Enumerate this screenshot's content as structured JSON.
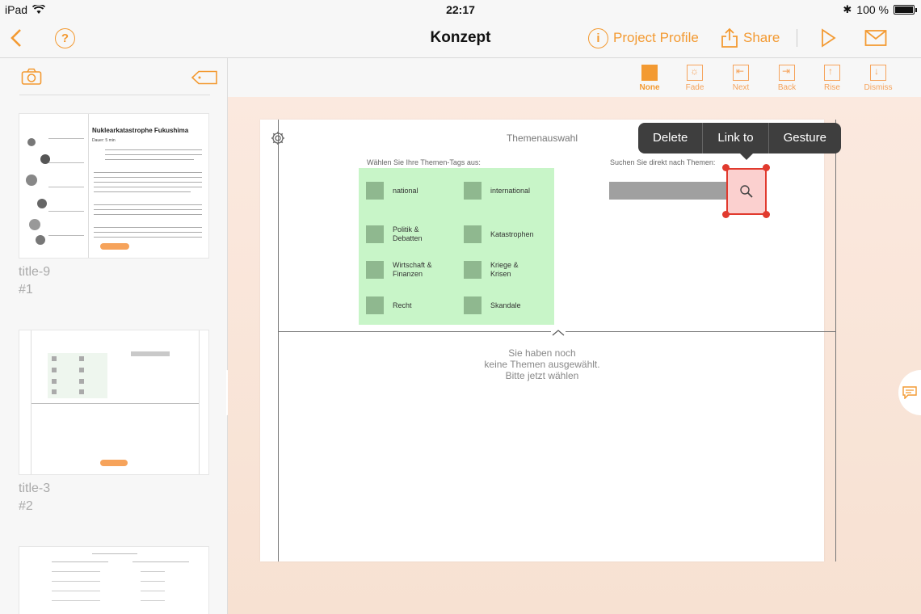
{
  "status": {
    "device": "iPad",
    "time": "22:17",
    "battery": "100 %"
  },
  "nav": {
    "title": "Konzept",
    "help": "?",
    "project_profile": "Project Profile",
    "project_profile_icon": "i",
    "share": "Share"
  },
  "sidebar": {
    "thumbnails": [
      {
        "title": "title-9",
        "number": "#1",
        "heading": "Nuklearkatastrophe Fukushima",
        "sub": "Dauer: 5 min"
      },
      {
        "title": "title-3",
        "number": "#2"
      },
      {
        "title": "",
        "number": ""
      }
    ]
  },
  "transitions": [
    {
      "label": "None",
      "icon": "none-icon",
      "active": true
    },
    {
      "label": "Fade",
      "icon": "fade-icon"
    },
    {
      "label": "Next",
      "icon": "next-icon"
    },
    {
      "label": "Back",
      "icon": "back-icon"
    },
    {
      "label": "Rise",
      "icon": "rise-icon"
    },
    {
      "label": "Dismiss",
      "icon": "dismiss-icon"
    }
  ],
  "page": {
    "title": "Themenauswahl",
    "tags_label": "Wählen Sie Ihre Themen-Tags aus:",
    "search_label": "Suchen Sie direkt nach Themen:",
    "tags": [
      "national",
      "international",
      "Politik &\nDebatten",
      "Katastrophen",
      "Wirtschaft &\nFinanzen",
      "Kriege &\nKrisen",
      "Recht",
      "Skandale"
    ],
    "empty_message": "Sie haben noch\nkeine Themen ausgewählt.\nBitte jetzt wählen"
  },
  "popup": {
    "options": [
      "Delete",
      "Link to",
      "Gesture"
    ]
  },
  "colors": {
    "accent": "#f39a32",
    "selection": "#e13a2e",
    "tag_panel": "#c8f5c8",
    "canvas_bg": "#fbe9df"
  }
}
